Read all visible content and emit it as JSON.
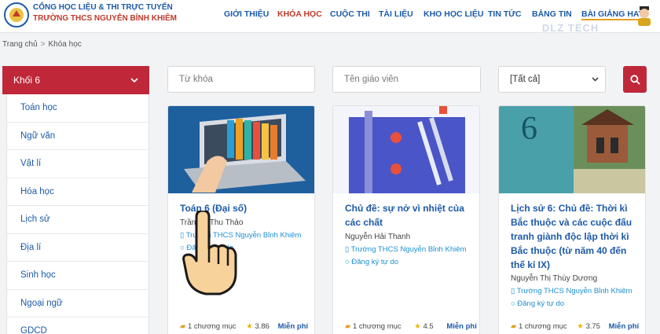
{
  "header": {
    "logo_line1": "CỔNG HỌC LIỆU & THI TRỰC TUYẾN",
    "logo_line2": "TRƯỜNG THCS NGUYỄN BỈNH KHIÊM",
    "nav": [
      "GIỚI THIỆU",
      "KHÓA HỌC",
      "CUỘC THI",
      "TÀI LIỆU",
      "KHO HỌC LIỆU",
      "TIN TỨC",
      "BẢNG TIN",
      "BÀI GIẢNG HAY"
    ],
    "active_nav": "KHÓA HỌC",
    "watermark": "DLZ TECH"
  },
  "breadcrumb": {
    "home": "Trang chủ",
    "sep": ">",
    "current": "Khóa học"
  },
  "sidebar": {
    "header": "Khối 6",
    "items": [
      "Toán học",
      "Ngữ văn",
      "Vật lí",
      "Hóa học",
      "Lịch sử",
      "Địa lí",
      "Sinh học",
      "Ngoại ngữ",
      "GDCD"
    ]
  },
  "filters": {
    "keyword_placeholder": "Từ khóa",
    "teacher_placeholder": "Tên giáo viên",
    "select_value": "[Tất cả]"
  },
  "courses": [
    {
      "title": "Toán 6",
      "subtitle": "(Đại số)",
      "author": "Trần Vũ Thu Thảo",
      "school": "Trường THCS Nguyễn Bỉnh Khiêm",
      "register": "Đăng ký tự do",
      "chapters": "1 chương mục",
      "rating": "3.86",
      "price": "Miễn phí"
    },
    {
      "title": "Chủ đề: sự nở vì nhiệt của các chất",
      "author": "Nguyễn Hải Thanh",
      "school": "Trường THCS Nguyễn Bỉnh Khiêm",
      "register": "Đăng ký tự do",
      "chapters": "1 chương mục",
      "rating": "4.5",
      "price": "Miễn phí"
    },
    {
      "title": "Lịch sử 6: Chủ đề: Thời kì Bắc thuộc và các cuộc đấu tranh giành độc lập thời kì Bắc thuộc (từ năm 40 đến thế kỉ IX)",
      "author": "Nguyễn Thị Thùy Dương",
      "school": "Trường THCS Nguyễn Bỉnh Khiêm",
      "register": "Đăng ký tự do",
      "chapters": "1 chương mục",
      "rating": "3.75",
      "price": "Miễn phí"
    }
  ],
  "colors": {
    "brand_red": "#c0283a",
    "link_blue": "#1d5aa8",
    "accent_blue": "#1d8fd0"
  }
}
